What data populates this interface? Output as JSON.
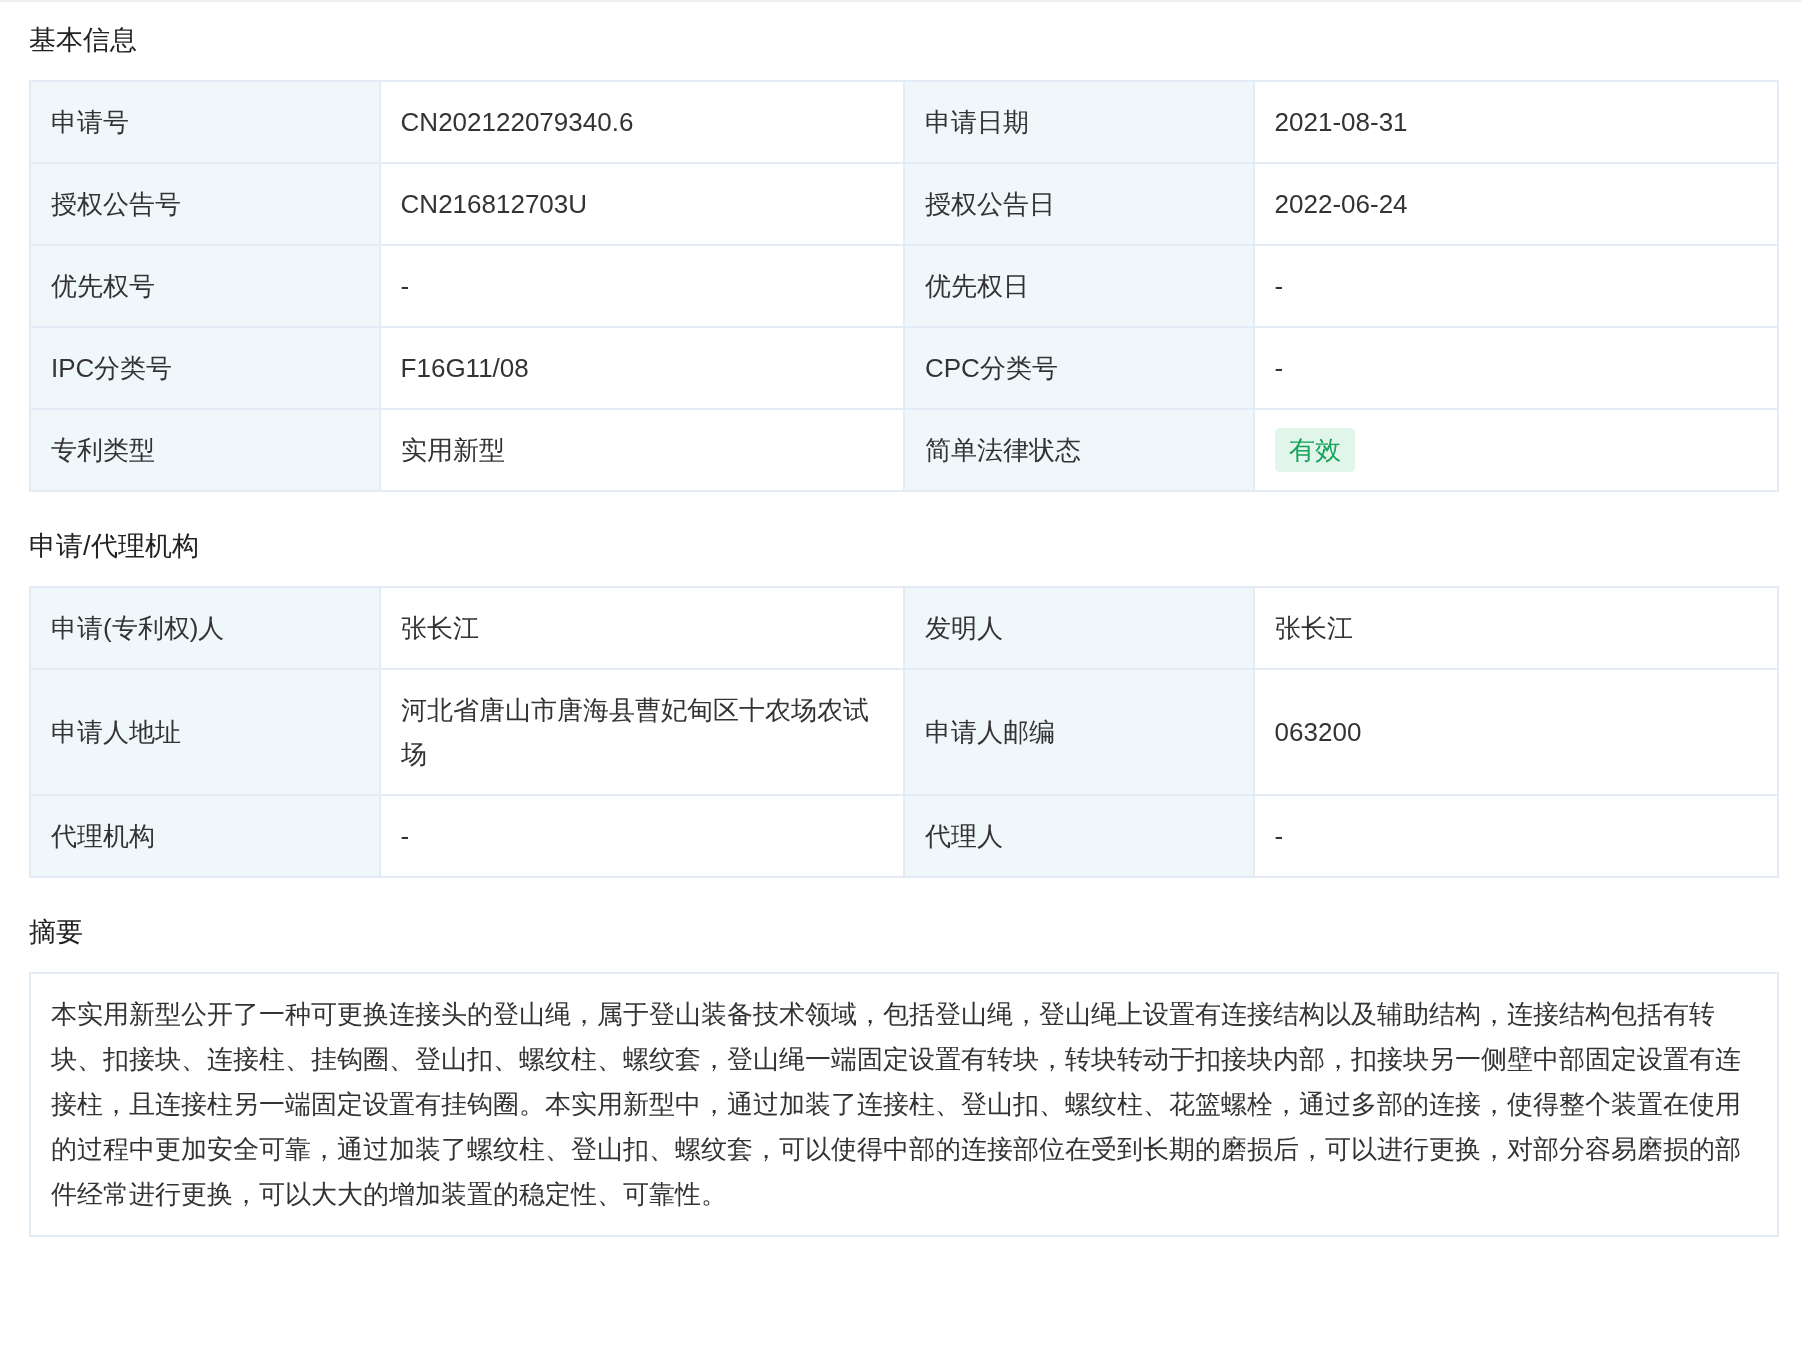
{
  "sections": [
    {
      "title": "基本信息",
      "kind": "table",
      "rows": [
        [
          {
            "label": "申请号",
            "value": "CN202122079340.6",
            "kind": "text"
          },
          {
            "label": "申请日期",
            "value": "2021-08-31",
            "kind": "text"
          }
        ],
        [
          {
            "label": "授权公告号",
            "value": "CN216812703U",
            "kind": "text"
          },
          {
            "label": "授权公告日",
            "value": "2022-06-24",
            "kind": "text"
          }
        ],
        [
          {
            "label": "优先权号",
            "value": "-",
            "kind": "text"
          },
          {
            "label": "优先权日",
            "value": "-",
            "kind": "text"
          }
        ],
        [
          {
            "label": "IPC分类号",
            "value": "F16G11/08",
            "kind": "text"
          },
          {
            "label": "CPC分类号",
            "value": "-",
            "kind": "text"
          }
        ],
        [
          {
            "label": "专利类型",
            "value": "实用新型",
            "kind": "text"
          },
          {
            "label": "简单法律状态",
            "value": "有效",
            "kind": "tag"
          }
        ]
      ]
    },
    {
      "title": "申请/代理机构",
      "kind": "table",
      "rows": [
        [
          {
            "label": "申请(专利权)人",
            "value": "张长江",
            "kind": "text"
          },
          {
            "label": "发明人",
            "value": "张长江",
            "kind": "text"
          }
        ],
        [
          {
            "label": "申请人地址",
            "value": "河北省唐山市唐海县曹妃甸区十农场农试场",
            "kind": "text"
          },
          {
            "label": "申请人邮编",
            "value": "063200",
            "kind": "text"
          }
        ],
        [
          {
            "label": "代理机构",
            "value": "-",
            "kind": "text"
          },
          {
            "label": "代理人",
            "value": "-",
            "kind": "text"
          }
        ]
      ]
    },
    {
      "title": "摘要",
      "kind": "text",
      "text": "本实用新型公开了一种可更换连接头的登山绳，属于登山装备技术领域，包括登山绳，登山绳上设置有连接结构以及辅助结构，连接结构包括有转块、扣接块、连接柱、挂钩圈、登山扣、螺纹柱、螺纹套，登山绳一端固定设置有转块，转块转动于扣接块内部，扣接块另一侧壁中部固定设置有连接柱，且连接柱另一端固定设置有挂钩圈。本实用新型中，通过加装了连接柱、登山扣、螺纹柱、花篮螺栓，通过多部的连接，使得整个装置在使用的过程中更加安全可靠，通过加装了螺纹柱、登山扣、螺纹套，可以使得中部的连接部位在受到长期的磨损后，可以进行更换，对部分容易磨损的部件经常进行更换，可以大大的增加装置的稳定性、可靠性。"
    }
  ]
}
